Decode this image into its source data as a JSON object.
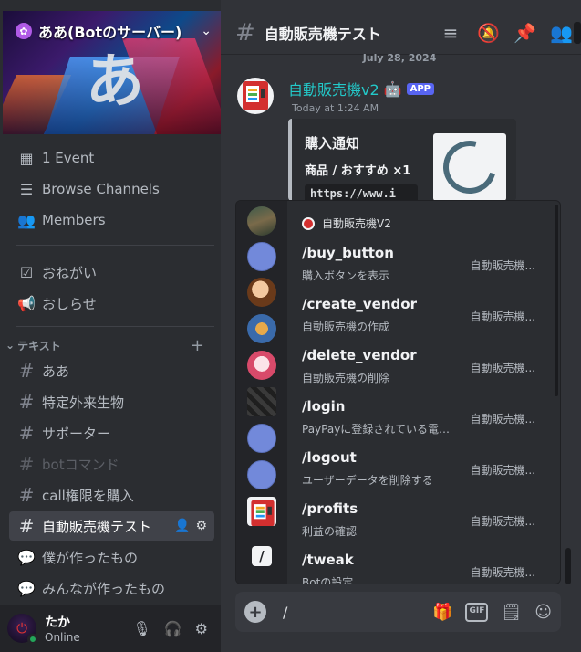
{
  "server": {
    "name": "ああ(Botのサーバー)",
    "banner_glyph": "あ"
  },
  "sidebar": {
    "top_items": [
      {
        "label": "1 Event",
        "icon": "calendar-icon"
      },
      {
        "label": "Browse Channels",
        "icon": "browse-channels-icon"
      },
      {
        "label": "Members",
        "icon": "members-icon"
      }
    ],
    "pinned": [
      {
        "label": "おねがい",
        "icon": "checkbox-icon"
      },
      {
        "label": "おしらせ",
        "icon": "megaphone-icon"
      }
    ],
    "category": "テキスト",
    "channels": [
      {
        "label": "ああ"
      },
      {
        "label": "特定外来生物"
      },
      {
        "label": "サポーター"
      },
      {
        "label": "botコマンド"
      },
      {
        "label": "call権限を購入"
      },
      {
        "label": "自動販売機テスト"
      },
      {
        "label": "僕が作ったもの"
      },
      {
        "label": "みんなが作ったもの"
      }
    ]
  },
  "user": {
    "name": "たか",
    "status": "Online"
  },
  "channel": {
    "title": "自動販売機テスト"
  },
  "messages": {
    "date": "July 28, 2024",
    "author": "自動販売機v2",
    "badge": "APP",
    "time": "Today at 1:24 AM",
    "embed": {
      "title": "購入通知",
      "field": "商品 / おすすめ ×1",
      "code": "https://www.i"
    }
  },
  "command_popup": {
    "header": "自動販売機V2",
    "commands": [
      {
        "name": "/buy_button",
        "desc": "購入ボタンを表示",
        "source": "自動販売機..."
      },
      {
        "name": "/create_vendor",
        "desc": "自動販売機の作成",
        "source": "自動販売機..."
      },
      {
        "name": "/delete_vendor",
        "desc": "自動販売機の削除",
        "source": "自動販売機..."
      },
      {
        "name": "/login",
        "desc": "PayPayに登録されている電話...",
        "source": "自動販売機..."
      },
      {
        "name": "/logout",
        "desc": "ユーザーデータを削除する",
        "source": "自動販売機..."
      },
      {
        "name": "/profits",
        "desc": "利益の確認",
        "source": "自動販売機..."
      },
      {
        "name": "/tweak",
        "desc": "Botの設定",
        "source": "自動販売機..."
      }
    ]
  },
  "composer": {
    "value": "/",
    "gif_label": "GIF"
  },
  "colors": {
    "app_badge": "#5865f2",
    "author": "#23c9c9",
    "online": "#23a55a"
  }
}
